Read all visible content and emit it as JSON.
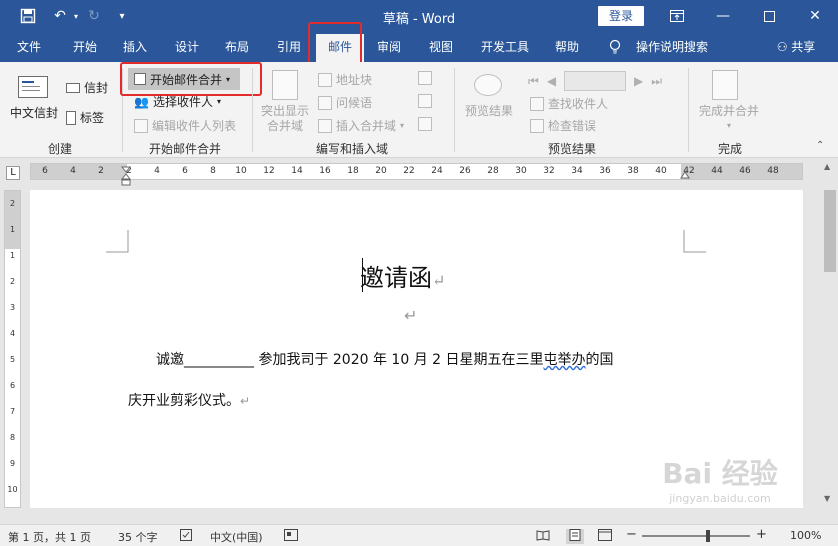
{
  "titlebar": {
    "title": "草稿  -  Word",
    "login_label": "登录",
    "icons": [
      "save-icon",
      "undo-icon",
      "redo-icon",
      "customize-icon"
    ]
  },
  "tabs": [
    {
      "label": "文件"
    },
    {
      "label": "开始"
    },
    {
      "label": "插入"
    },
    {
      "label": "设计"
    },
    {
      "label": "布局"
    },
    {
      "label": "引用"
    },
    {
      "label": "邮件",
      "active": true
    },
    {
      "label": "审阅"
    },
    {
      "label": "视图"
    },
    {
      "label": "开发工具"
    },
    {
      "label": "帮助"
    },
    {
      "label": "操作说明搜索"
    }
  ],
  "share_label": "共享",
  "ribbon": {
    "create": {
      "label": "创建",
      "chinese_envelope": "中文信封",
      "envelope": "信封",
      "labels": "标签"
    },
    "start_merge": {
      "label": "开始邮件合并",
      "start": "开始邮件合并",
      "select": "选择收件人",
      "edit": "编辑收件人列表"
    },
    "write_insert": {
      "label": "编写和插入域",
      "highlight": "突出显示\n合并域",
      "address": "地址块",
      "greeting": "问候语",
      "insert_field": "插入合并域"
    },
    "preview": {
      "label": "预览结果",
      "preview_btn": "预览结果",
      "find": "查找收件人",
      "check": "检查错误"
    },
    "finish": {
      "label": "完成",
      "finish_btn": "完成并合并"
    }
  },
  "ruler_ticks": [
    "6",
    "4",
    "2",
    "2",
    "4",
    "6",
    "8",
    "10",
    "12",
    "14",
    "16",
    "18",
    "20",
    "22",
    "24",
    "26",
    "28",
    "30",
    "32",
    "34",
    "36",
    "38",
    "40",
    "42",
    "44",
    "46",
    "48"
  ],
  "vruler_ticks": [
    "2",
    "1",
    "1",
    "2",
    "3",
    "4",
    "5",
    "6",
    "7",
    "8",
    "9",
    "10",
    "11"
  ],
  "document": {
    "heading": "邀请函",
    "line1_prefix": "诚邀",
    "line1_blank": "__________",
    "line1_main": " 参加我司于 2020 年 10 月 2 日星期五在三里",
    "line1_wavy": "屯举办",
    "line1_end": "的国",
    "line2": "庆开业剪彩仪式。"
  },
  "status": {
    "page": "第 1 页，共 1 页",
    "words": "35 个字",
    "lang": "中文(中国)",
    "zoom": "100%",
    "zoom_level": 1.0
  },
  "watermark": {
    "main": "Bai 经验",
    "sub": "jingyan.baidu.com"
  },
  "colors": {
    "accent": "#2b579a",
    "highlight_box": "#e42a2a"
  }
}
